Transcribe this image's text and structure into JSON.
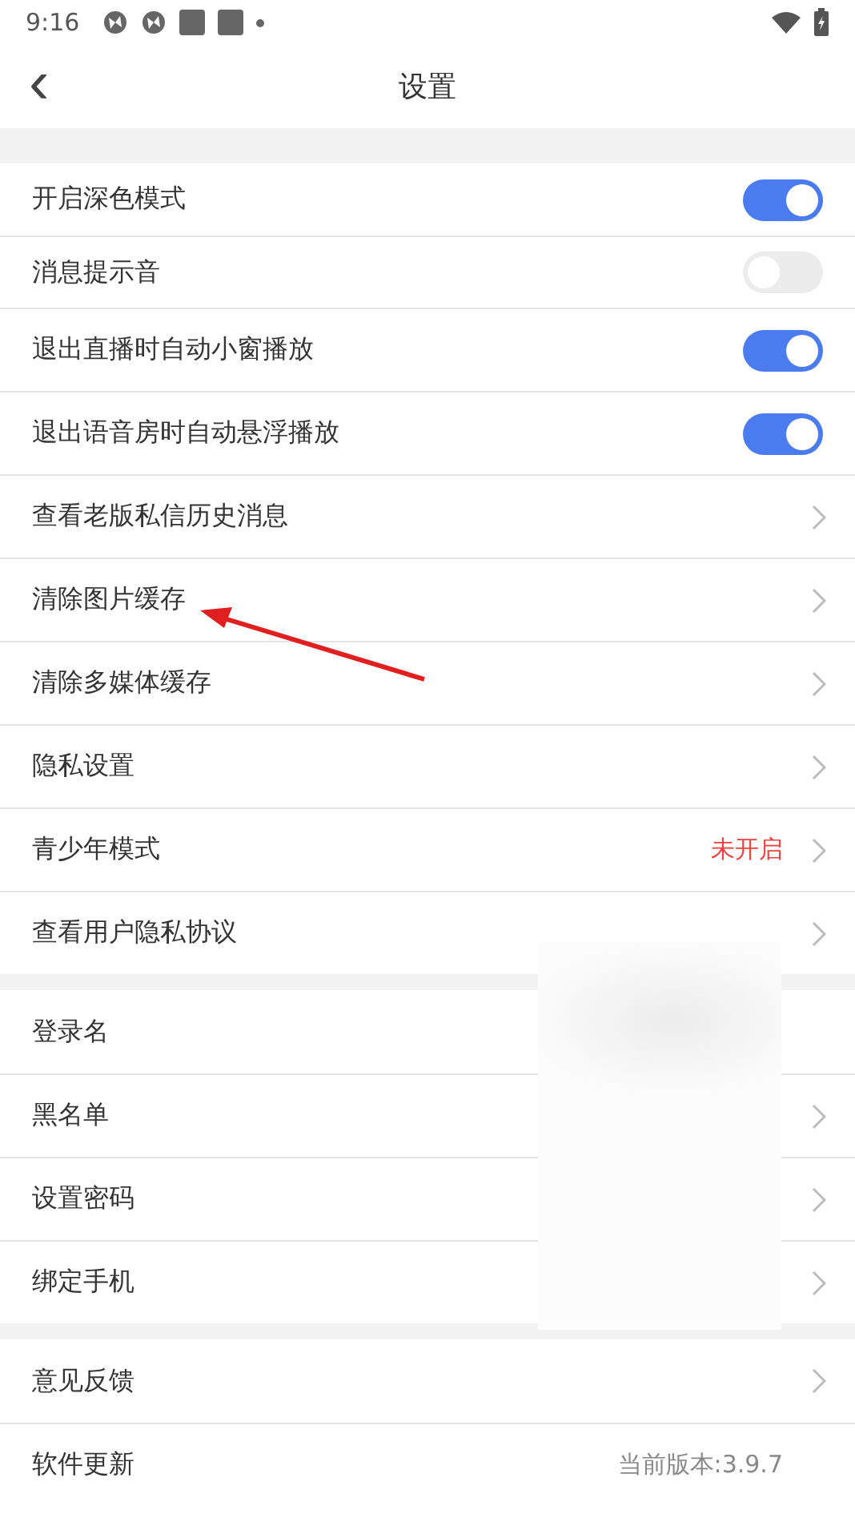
{
  "status_bar": {
    "time": "9:16"
  },
  "header": {
    "back": "‹",
    "title": "设置"
  },
  "sections": [
    {
      "rows": [
        {
          "kind": "toggle",
          "label": "开启深色模式",
          "on": true
        },
        {
          "kind": "toggle",
          "label": "消息提示音",
          "on": false
        },
        {
          "kind": "toggle",
          "label": "退出直播时自动小窗播放",
          "on": true
        },
        {
          "kind": "toggle",
          "label": "退出语音房时自动悬浮播放",
          "on": true
        },
        {
          "kind": "link",
          "label": "查看老版私信历史消息",
          "chevron": true
        },
        {
          "kind": "link",
          "label": "清除图片缓存",
          "chevron": true
        },
        {
          "kind": "link",
          "label": "清除多媒体缓存",
          "chevron": true
        },
        {
          "kind": "link",
          "label": "隐私设置",
          "chevron": true
        },
        {
          "kind": "link",
          "label": "青少年模式",
          "value": "未开启",
          "chevron": true
        },
        {
          "kind": "link",
          "label": "查看用户隐私协议",
          "chevron": true
        }
      ]
    },
    {
      "rows": [
        {
          "kind": "link",
          "label": "登录名",
          "chevron": false
        },
        {
          "kind": "link",
          "label": "黑名单",
          "chevron": true
        },
        {
          "kind": "link",
          "label": "设置密码",
          "chevron": true
        },
        {
          "kind": "link",
          "label": "绑定手机",
          "chevron": true
        }
      ]
    },
    {
      "rows": [
        {
          "kind": "link",
          "label": "意见反馈",
          "chevron": true
        },
        {
          "kind": "link",
          "label": "软件更新",
          "value": "当前版本:3.9.7",
          "chevron": false
        }
      ]
    }
  ]
}
